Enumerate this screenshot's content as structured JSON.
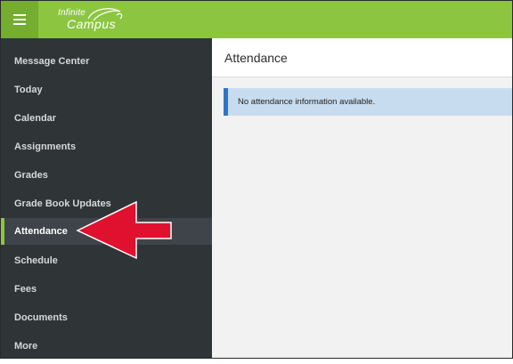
{
  "app": {
    "logo_line1": "Infinite",
    "logo_line2": "Campus"
  },
  "icons": {
    "menu": "hamburger-menu-icon",
    "logo_swoosh": "campus-logo-swoosh",
    "arrow": "red-pointer-arrow"
  },
  "colors": {
    "topbar": "#8cc641",
    "sidebar": "#2f3437",
    "active_accent": "#8cc641",
    "notice_bg": "#c8dcef",
    "notice_border": "#2f76c2",
    "arrow": "#e0112e"
  },
  "sidebar": {
    "items": [
      {
        "label": "Message Center"
      },
      {
        "label": "Today"
      },
      {
        "label": "Calendar"
      },
      {
        "label": "Assignments"
      },
      {
        "label": "Grades"
      },
      {
        "label": "Grade Book Updates"
      },
      {
        "label": "Attendance",
        "active": true
      },
      {
        "label": "Schedule"
      },
      {
        "label": "Fees"
      },
      {
        "label": "Documents"
      },
      {
        "label": "More"
      }
    ]
  },
  "main": {
    "title": "Attendance",
    "notice": "No attendance information available."
  }
}
